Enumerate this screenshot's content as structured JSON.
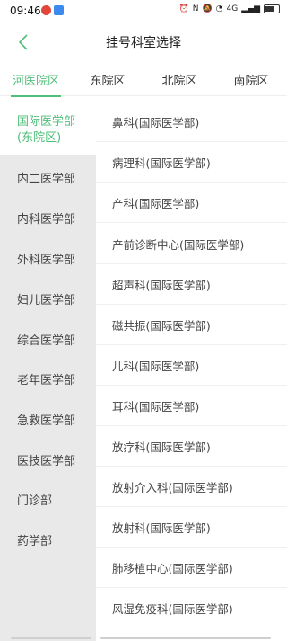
{
  "status_bar": {
    "time": "09:46",
    "network_label": "4G",
    "icon_colors": {
      "weibo": "#e0463a",
      "app": "#3b8af0"
    },
    "icons": [
      "weibo-icon",
      "app-icon",
      "alarm-icon",
      "nfc-icon",
      "mute-icon",
      "wifi-icon",
      "signal-icon",
      "battery-icon"
    ]
  },
  "header": {
    "title": "挂号科室选择",
    "back_icon": "chevron-left-icon"
  },
  "tabs": [
    {
      "label": "河医院区",
      "active": true
    },
    {
      "label": "东院区",
      "active": false
    },
    {
      "label": "北院区",
      "active": false
    },
    {
      "label": "南院区",
      "active": false
    }
  ],
  "departments": [
    {
      "line1": "国际医学部",
      "line2": "(东院区)",
      "active": true
    },
    {
      "line1": "内二医学部"
    },
    {
      "line1": "内科医学部"
    },
    {
      "line1": "外科医学部"
    },
    {
      "line1": "妇儿医学部"
    },
    {
      "line1": "综合医学部"
    },
    {
      "line1": "老年医学部"
    },
    {
      "line1": "急救医学部"
    },
    {
      "line1": "医技医学部"
    },
    {
      "line1": "门诊部"
    },
    {
      "line1": "药学部"
    }
  ],
  "clinics": [
    "鼻科(国际医学部)",
    "病理科(国际医学部)",
    "产科(国际医学部)",
    "产前诊断中心(国际医学部)",
    "超声科(国际医学部)",
    "磁共振(国际医学部)",
    "儿科(国际医学部)",
    "耳科(国际医学部)",
    "放疗科(国际医学部)",
    "放射介入科(国际医学部)",
    "放射科(国际医学部)",
    "肺移植中心(国际医学部)",
    "风湿免疫科(国际医学部)"
  ],
  "colors": {
    "accent": "#4fbe7a",
    "left_bg": "#e9e9e9",
    "divider": "#efefef"
  }
}
